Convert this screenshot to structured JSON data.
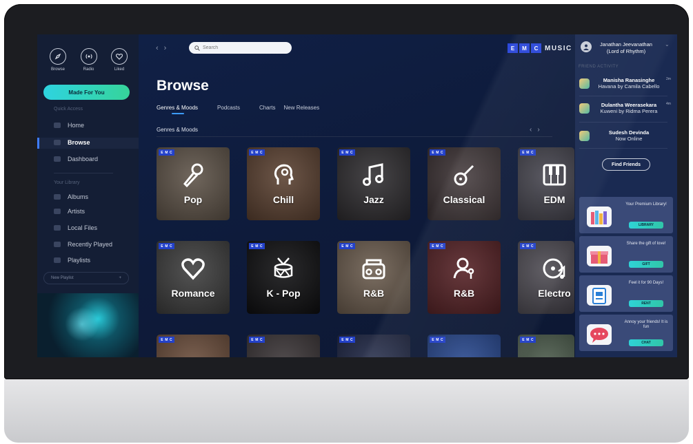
{
  "app": {
    "brand_letters": [
      "E",
      "M",
      "C"
    ],
    "brand_word": "MUSIC"
  },
  "sidebar": {
    "top_icons": [
      {
        "label": "Browse",
        "icon": "compass-icon"
      },
      {
        "label": "Radio",
        "icon": "radio-icon"
      },
      {
        "label": "Liked",
        "icon": "heart-icon"
      }
    ],
    "made_for_you": "Made For You",
    "quick_access_title": "Quick Access",
    "quick_access": [
      "Home",
      "Browse",
      "Dashboard"
    ],
    "library_title": "Your Library",
    "library": [
      "Albums",
      "Artists",
      "Local Files",
      "Recently Played",
      "Playlists"
    ],
    "new_playlist": "New Playlist",
    "new_playlist_plus": "+"
  },
  "header": {
    "search_placeholder": "Search",
    "back": "‹",
    "forward": "›"
  },
  "main": {
    "title": "Browse",
    "tabs": [
      "Genres & Moods",
      "Podcasts",
      "Charts",
      "New Releases"
    ],
    "section_title": "Genres & Moods",
    "badge": [
      "E",
      "M",
      "C"
    ],
    "cards_row1": [
      {
        "name": "Pop",
        "icon": "microphone-icon",
        "bg": "#5d5247"
      },
      {
        "name": "Chill",
        "icon": "head-icon",
        "bg": "#5a4030"
      },
      {
        "name": "Jazz",
        "icon": "music-note-icon",
        "bg": "#2e2c2f"
      },
      {
        "name": "Classical",
        "icon": "guitar-icon",
        "bg": "#3a3032"
      },
      {
        "name": "EDM",
        "icon": "piano-icon",
        "bg": "#3b3a44"
      }
    ],
    "cards_row2": [
      {
        "name": "Romance",
        "icon": "heart-outline-icon",
        "bg": "#3c3c3c"
      },
      {
        "name": "K - Pop",
        "icon": "drum-icon",
        "bg": "#0e0e10"
      },
      {
        "name": "R&B",
        "icon": "boombox-icon",
        "bg": "#6a5b4d"
      },
      {
        "name": "R&B",
        "icon": "singer-icon",
        "bg": "#4b1418"
      },
      {
        "name": "Electro",
        "icon": "vinyl-icon",
        "bg": "#45424a"
      }
    ],
    "cards_row3_bg": [
      "#6a4c3a",
      "#3a3436",
      "#1d2544",
      "#1d3f8a",
      "#4a5a4a"
    ]
  },
  "right": {
    "user_name": "Janathan Jeevanathan",
    "user_sub": "(Lord of Rhythm)",
    "friend_activity_title": "FRIEND ACTIVITY",
    "friends": [
      {
        "name": "Manisha Ranasinghe",
        "sub": "Havana by Camila Cabello",
        "time": "2m"
      },
      {
        "name": "Dulantha Weerasekara",
        "sub": "Kuweni by Ridma Perera",
        "time": "4m"
      },
      {
        "name": "Sudesh Devinda",
        "sub": "Now Online",
        "time": ""
      }
    ],
    "find_friends": "Find Friends",
    "promos": [
      {
        "text": "Your Premium Library!",
        "btn": "LIBRARY",
        "icon": "books-icon"
      },
      {
        "text": "Share the gift of love!",
        "btn": "GIFT",
        "icon": "gift-icon"
      },
      {
        "text": "Feel it for 90 Days!",
        "btn": "RENT",
        "icon": "calendar-icon"
      },
      {
        "text": "Annoy your friends! It is fun",
        "btn": "CHAT",
        "icon": "chat-icon"
      }
    ]
  }
}
